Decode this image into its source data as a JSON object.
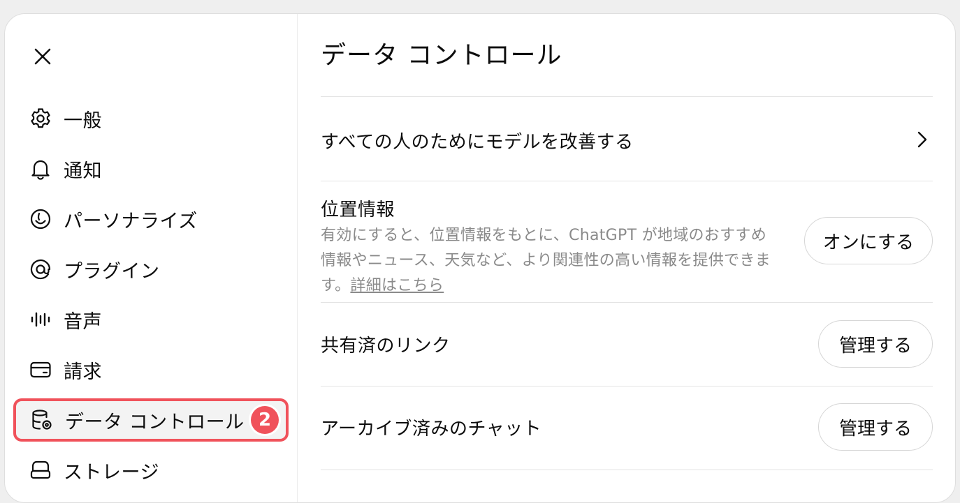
{
  "sidebar": {
    "items": [
      {
        "label": "一般",
        "icon": "gear-icon"
      },
      {
        "label": "通知",
        "icon": "bell-icon"
      },
      {
        "label": "パーソナライズ",
        "icon": "personalize-icon"
      },
      {
        "label": "プラグイン",
        "icon": "plugin-icon"
      },
      {
        "label": "音声",
        "icon": "waveform-icon"
      },
      {
        "label": "請求",
        "icon": "credit-card-icon"
      },
      {
        "label": "データ コントロール",
        "icon": "database-gear-icon",
        "active": true,
        "badge": "2"
      },
      {
        "label": "ストレージ",
        "icon": "storage-icon"
      }
    ],
    "active_outline_color": "#f0525b"
  },
  "main": {
    "title": "データ コントロール",
    "improve_model": {
      "label": "すべての人のためにモデルを改善する"
    },
    "location": {
      "label": "位置情報",
      "description": "有効にすると、位置情報をもとに、ChatGPT が地域のおすすめ情報やニュース、天気など、より関連性の高い情報を提供できます。",
      "link_text": "詳細はこちら",
      "button": "オンにする"
    },
    "shared_links": {
      "label": "共有済のリンク",
      "button": "管理する"
    },
    "archived_chats": {
      "label": "アーカイブ済みのチャット",
      "button": "管理する"
    }
  }
}
